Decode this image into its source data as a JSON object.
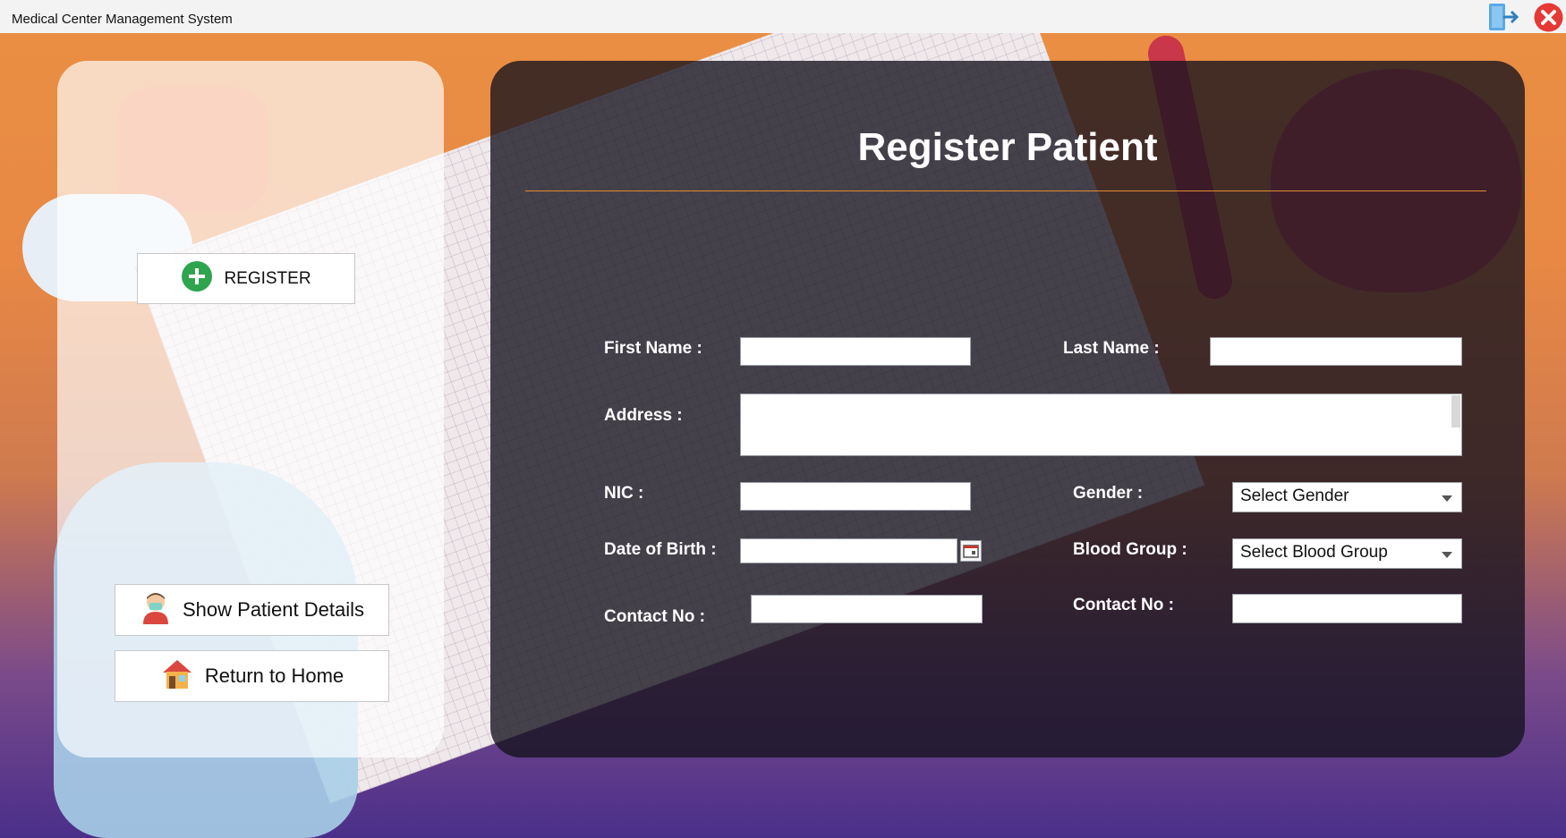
{
  "window": {
    "title": "Medical Center Management System",
    "logout_icon": "logout-icon",
    "close_icon": "close-icon"
  },
  "sidebar": {
    "register_label": "REGISTER",
    "register_icon": "plus-circle-icon",
    "show_patient_label": "Show Patient Details",
    "show_patient_icon": "patient-avatar-icon",
    "home_label": "Return to Home",
    "home_icon": "house-icon"
  },
  "form": {
    "title": "Register Patient",
    "first_name_label": "First Name  :",
    "first_name_value": "",
    "last_name_label": "Last Name  :",
    "last_name_value": "",
    "address_label": "Address  :",
    "address_value": "",
    "nic_label": "NIC  :",
    "nic_value": "",
    "gender_label": "Gender  :",
    "gender_selected": "Select Gender",
    "dob_label": "Date of Birth  :",
    "dob_value": "",
    "blood_group_label": "Blood Group  :",
    "blood_group_selected": "Select Blood Group",
    "contact_label_1": "Contact No  :",
    "contact_value_1": "",
    "contact_label_2": "Contact No  :",
    "contact_value_2": ""
  },
  "colors": {
    "accent_divider": "#e08a32",
    "register_green": "#2ea44f",
    "close_red": "#e53935"
  }
}
